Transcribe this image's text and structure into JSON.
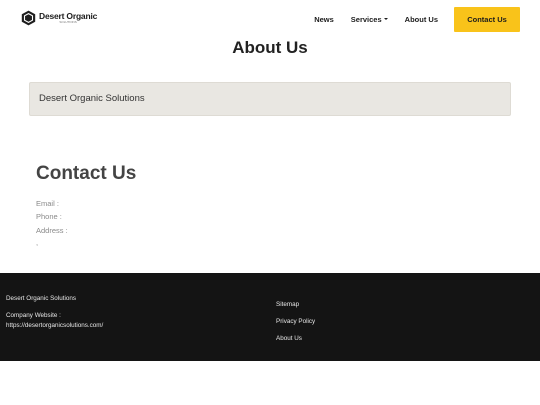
{
  "brand": {
    "name": "Desert Organic",
    "tagline": "SOLUTIONS"
  },
  "nav": {
    "news": "News",
    "services": "Services",
    "about": "About Us",
    "contact_button": "Contact Us"
  },
  "page": {
    "title": "About Us",
    "company_name": "Desert Organic Solutions"
  },
  "contact": {
    "heading": "Contact Us",
    "email_label": "Email :",
    "phone_label": "Phone :",
    "address_label": "Address :",
    "address_extra": ","
  },
  "footer": {
    "company_name": "Desert Organic Solutions",
    "website_label": "Company Website :",
    "website_url": "https://desertorganicsolutions.com/",
    "links": {
      "sitemap": "Sitemap",
      "privacy": "Privacy Policy",
      "about": "About Us"
    }
  },
  "colors": {
    "accent": "#f9c31a",
    "card_background": "#e9e7e2",
    "footer_background": "#141414"
  },
  "icons": {
    "logo": "hexagon-logo-icon",
    "services_dropdown": "caret-down-icon"
  }
}
